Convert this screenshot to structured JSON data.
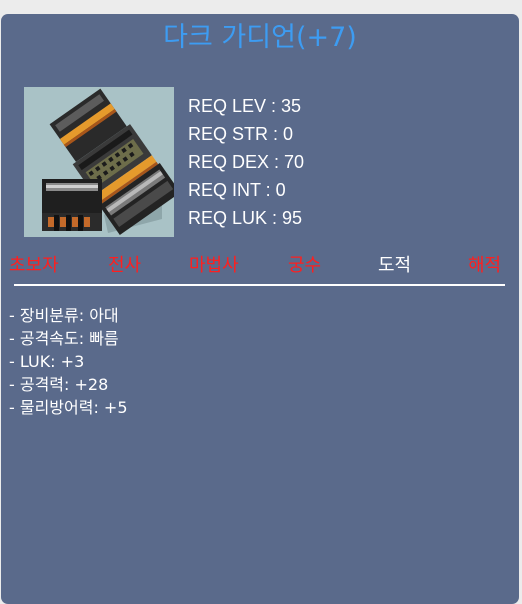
{
  "item": {
    "name": "다크 가디언(+7)",
    "name_color": "#3d9cf2",
    "icon": "dark-glove-icon"
  },
  "requirements": [
    "REQ LEV : 35",
    "REQ STR : 0",
    "REQ DEX : 70",
    "REQ INT : 0",
    "REQ LUK : 95"
  ],
  "jobs": [
    {
      "label": "초보자",
      "color": "#ff1f1f"
    },
    {
      "label": "전사",
      "color": "#ff1f1f"
    },
    {
      "label": "마법사",
      "color": "#ff1f1f"
    },
    {
      "label": "궁수",
      "color": "#ff1f1f"
    },
    {
      "label": "도적",
      "color": "#ffffff"
    },
    {
      "label": "해적",
      "color": "#ff1f1f"
    }
  ],
  "stats": [
    "- 장비분류: 아대",
    "- 공격속도: 빠름",
    "- LUK: +3",
    "- 공격력: +28",
    "- 물리방어력: +5"
  ],
  "colors": {
    "panel": "#5a6a8b",
    "accent_title": "#3d9cf2",
    "unavailable_job": "#ff1f1f",
    "available_job": "#ffffff"
  }
}
